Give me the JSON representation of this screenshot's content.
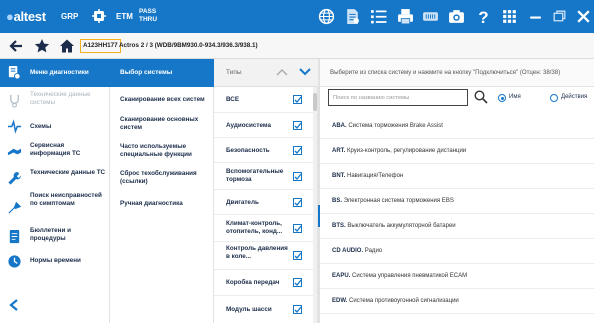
{
  "topbar": {
    "logo": "altest",
    "grp": "GRP",
    "etm": "ETM",
    "pass_line1": "PASS",
    "pass_line2": "THRU",
    "icons": [
      "globe-icon",
      "document-icon",
      "list-icon",
      "printer-icon",
      "vci-icon",
      "camera-icon",
      "help-icon",
      "grid-icon",
      "minimize-icon",
      "restore-icon",
      "close-icon"
    ],
    "accent": "#1677c9"
  },
  "navbar": {
    "vin": "A123HH177",
    "vehicle": "Actros 2 / 3 (WDB/9BM930.0-934.3/936.3/938.1)"
  },
  "sidebar": {
    "items": [
      {
        "label": "Меню диагностики",
        "icon": "car-diagnostics-icon",
        "active": true
      },
      {
        "label": "Технические данные системы",
        "icon": "stethoscope-icon",
        "disabled": true
      },
      {
        "label": "Схемы",
        "icon": "schematic-icon"
      },
      {
        "label": "Сервисная информация ТС",
        "icon": "truck-service-icon"
      },
      {
        "label": "Технические данные ТС",
        "icon": "wrench-icon"
      },
      {
        "label": "Поиск неисправностей по симптомам",
        "icon": "troubleshoot-icon"
      },
      {
        "label": "Бюллетени и процедуры",
        "icon": "bulletin-icon"
      },
      {
        "label": "Нормы времени",
        "icon": "clock-icon"
      }
    ]
  },
  "col2": {
    "header": "Выбор системы",
    "items": [
      "Сканирование всех систем",
      "Сканирование основных систем",
      "Часто используемые специальные функции",
      "Сброс техобслуживания (ссылки)",
      "Ручная диагностика"
    ]
  },
  "col3": {
    "header": "Типы",
    "items": [
      {
        "label": "ВСЕ",
        "checked": true
      },
      {
        "label": "Аудиосистема",
        "checked": true
      },
      {
        "label": "Безопасность",
        "checked": true
      },
      {
        "label": "Вспомогательные тормоза",
        "checked": true
      },
      {
        "label": "Двигатель",
        "checked": true
      },
      {
        "label": "Климат-контроль, отопитель, конд...",
        "checked": true
      },
      {
        "label": "Контроль давления в коле...",
        "checked": true
      },
      {
        "label": "Коробка передач",
        "checked": true
      },
      {
        "label": "Модуль шасси",
        "checked": true
      }
    ]
  },
  "right": {
    "header": "Выберите из списка систему и нажмите на кнопку \"Подключиться\" (Отцен: 38/38)",
    "search_placeholder": "Поиск по названию системы",
    "radio_name": "Имя",
    "radio_action": "Действия",
    "radio_selected": "name",
    "systems": [
      {
        "code": "ABA.",
        "name": "Система торможения Brake Assist"
      },
      {
        "code": "ART.",
        "name": "Круиз-контроль, регулирование дистанции"
      },
      {
        "code": "BNT.",
        "name": "Навигация/Телефон"
      },
      {
        "code": "BS.",
        "name": "Электронная система торможения EBS"
      },
      {
        "code": "BTS.",
        "name": "Выключатель аккумуляторной батареи"
      },
      {
        "code": "CD AUDIO.",
        "name": "Радио"
      },
      {
        "code": "EAPU.",
        "name": "Система управления пневматикой ECAM"
      },
      {
        "code": "EDW.",
        "name": "Система противоугонной сигнализации"
      }
    ]
  }
}
